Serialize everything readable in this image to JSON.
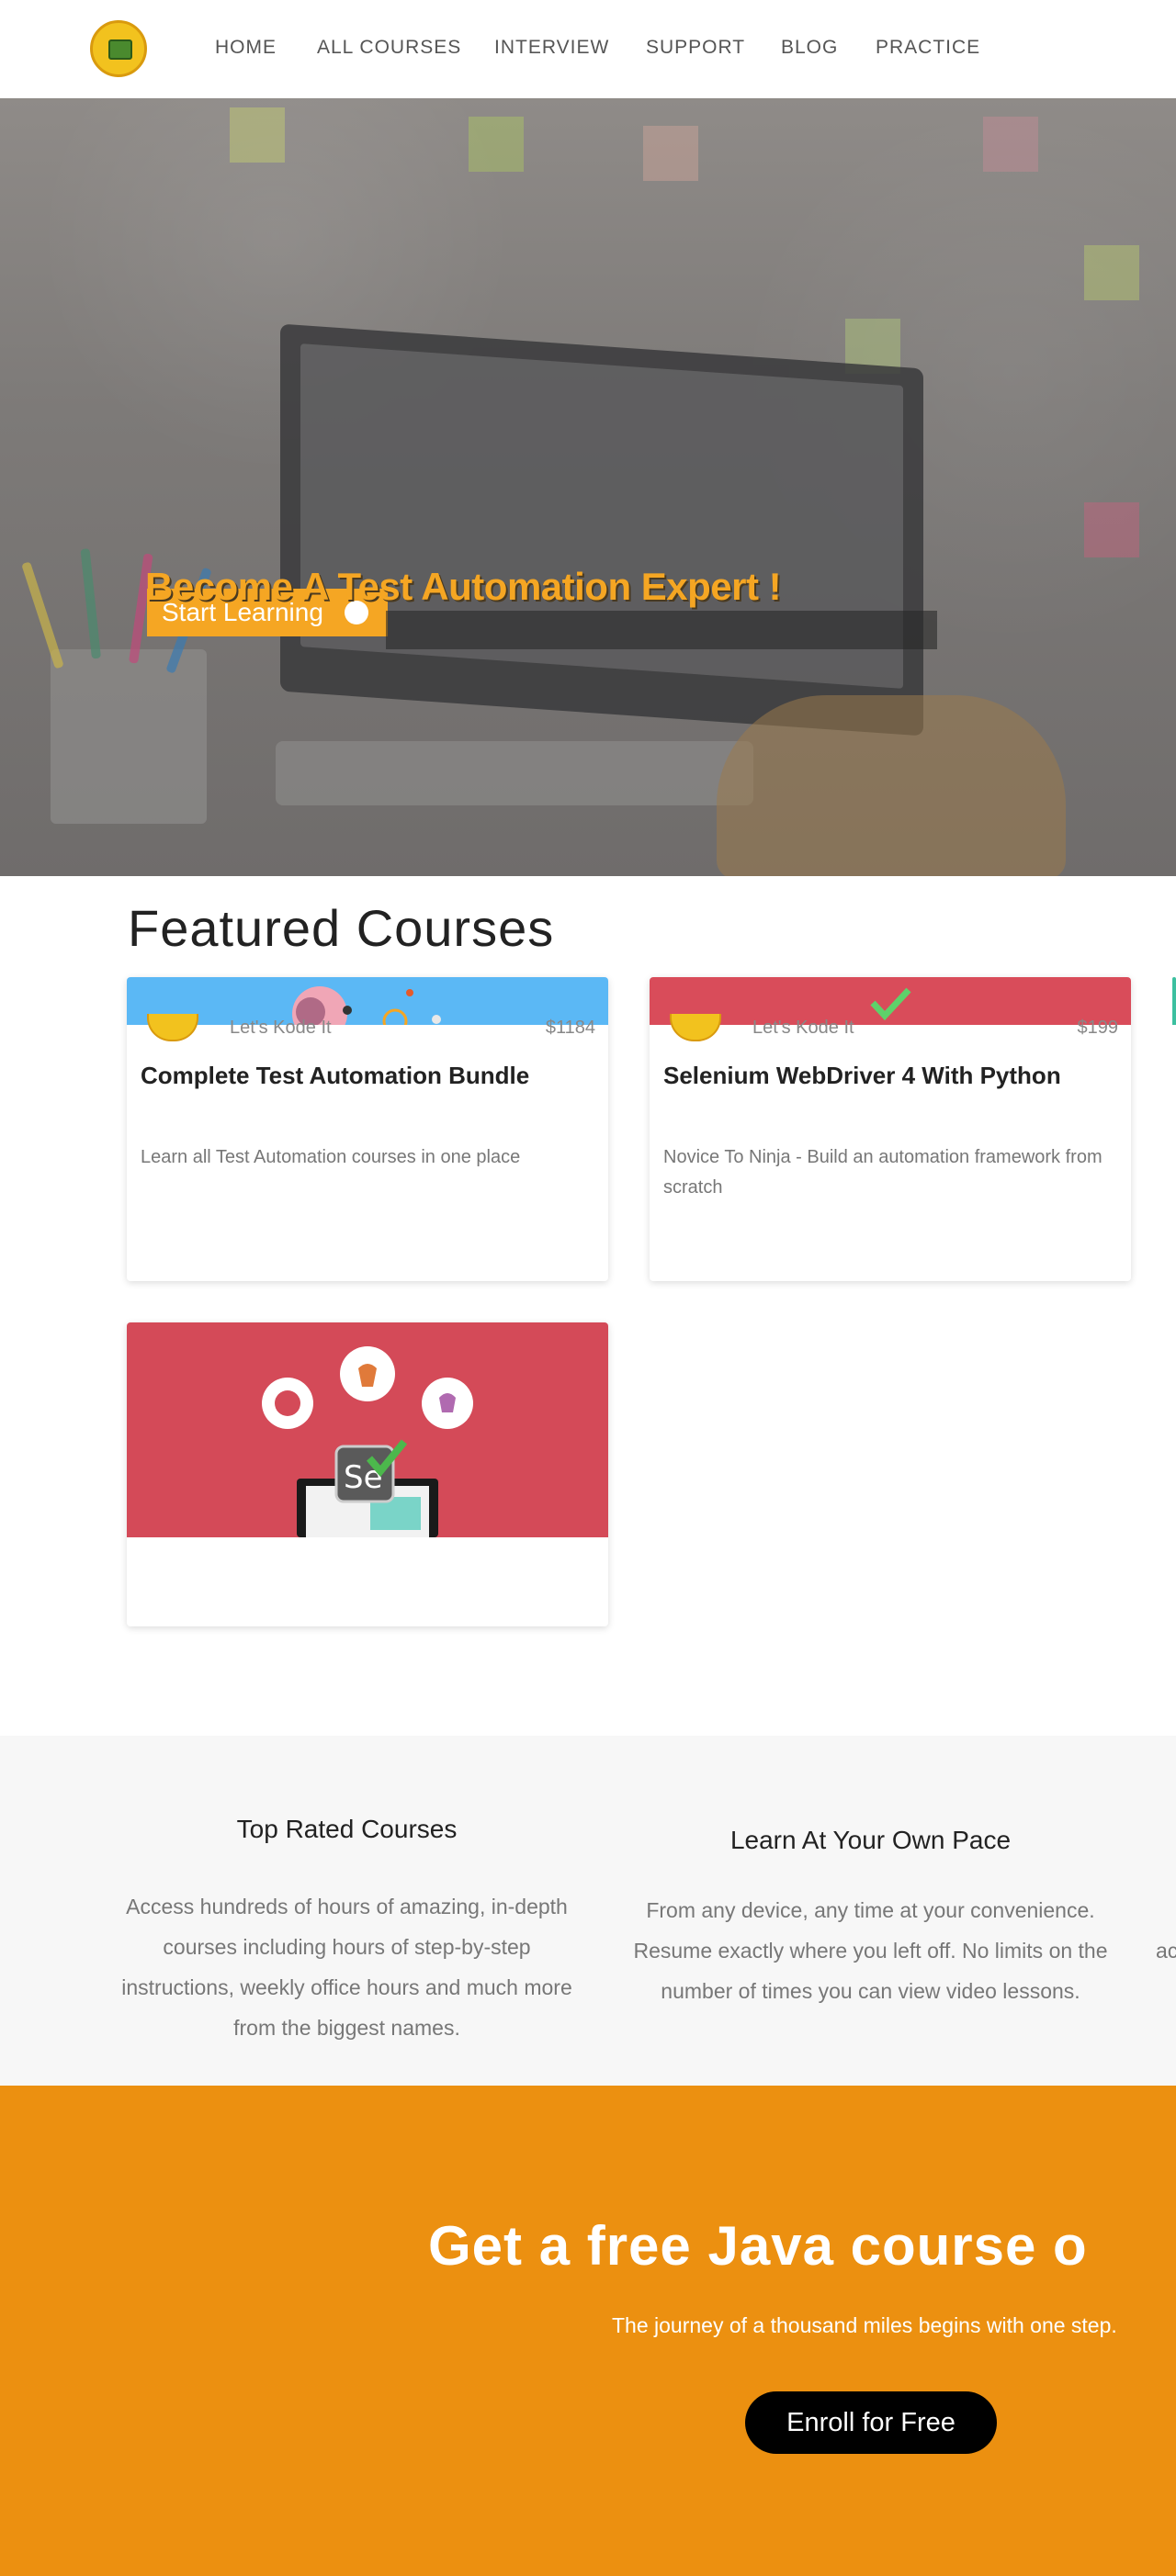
{
  "nav": {
    "logo_icon": "letskodeit-logo-icon",
    "items": [
      {
        "label": "HOME"
      },
      {
        "label": "ALL COURSES"
      },
      {
        "label": "INTERVIEW"
      },
      {
        "label": "SUPPORT"
      },
      {
        "label": "BLOG"
      },
      {
        "label": "PRACTICE"
      }
    ]
  },
  "hero": {
    "title": "Become A Test Automation Expert !",
    "button_label": "Start Learning",
    "button_icon": "arrow-right-circle-icon",
    "accent_color": "#f5a623"
  },
  "featured": {
    "heading": "Featured Courses",
    "courses": [
      {
        "author": "Let's Kode It",
        "price": "$1184",
        "title": "Complete Test Automation Bundle",
        "description": "Learn all Test Automation courses in one place",
        "image_color": "#5bb8f5"
      },
      {
        "author": "Let's Kode It",
        "price": "$199",
        "title": "Selenium WebDriver 4 With Python",
        "description": "Novice To Ninja - Build an automation framework from scratch",
        "image_color": "#d94c5a"
      },
      {
        "author": "",
        "price": "",
        "title": "",
        "description": "",
        "image_color": "#d44a58"
      }
    ]
  },
  "features": [
    {
      "title": "Top Rated Courses",
      "text": "Access hundreds of hours of amazing, in-depth courses including hours of step-by-step instructions, weekly office hours and much more from the biggest names."
    },
    {
      "title": "Learn At Your Own Pace",
      "text": "From any device, any time at your convenience. Resume exactly where you left off. No limits on the number of times you can view video lessons."
    },
    {
      "text_fragment": "ac"
    }
  ],
  "cta": {
    "title": "Get a free Java course o",
    "subtitle": "The journey of a thousand miles begins with one step.",
    "button_label": "Enroll for Free",
    "background_color": "#ec9010"
  }
}
